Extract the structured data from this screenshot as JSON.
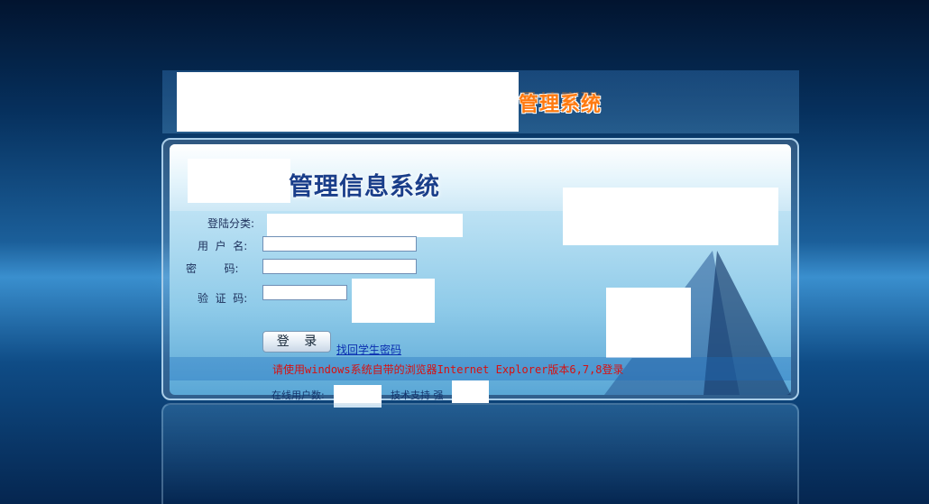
{
  "header": {
    "system_title_right": "管理系统",
    "system_title_reflection": "管理系统"
  },
  "panel": {
    "title": "管理信息系统"
  },
  "form": {
    "login_category_label": "登陆分类:",
    "username_label": "用  户  名:",
    "password_label": "密        码:",
    "captcha_label": "验  证  码:",
    "username_value": "",
    "password_value": "",
    "captcha_value": "",
    "login_button": "登 录",
    "forgot_link": "找回学生密码"
  },
  "notice": {
    "text": "请使用windows系统自带的浏览器Internet Explorer版本6,7,8登录"
  },
  "footer": {
    "online_users_label": "在线用户数:",
    "tech_support_label": "技术支持 强"
  },
  "colors": {
    "title_orange": "#ff7a10",
    "title_blue": "#1a3e8a",
    "notice_red": "#d81010",
    "link_blue": "#0a2fb0"
  }
}
